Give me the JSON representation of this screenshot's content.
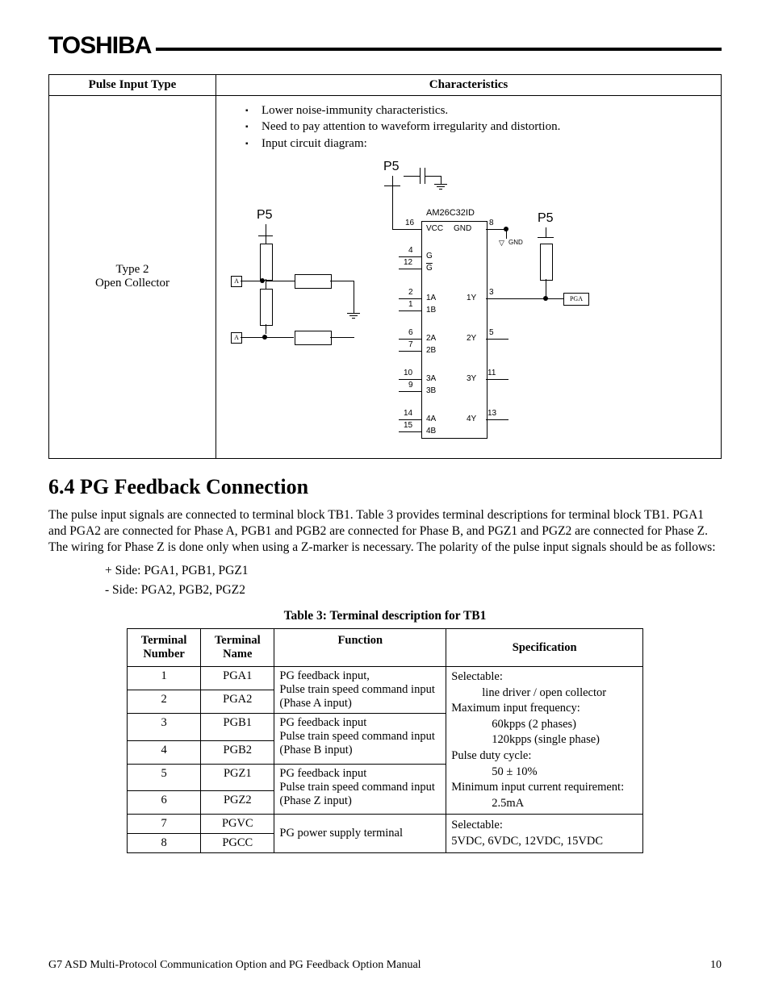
{
  "brand": "TOSHIBA",
  "table1": {
    "headers": [
      "Pulse Input Type",
      "Characteristics"
    ],
    "row_label": "Type 2\nOpen Collector",
    "bullets": [
      "Lower noise-immunity characteristics.",
      "Need to pay attention to waveform irregularity and distortion.",
      "Input circuit diagram:"
    ],
    "diagram_labels": {
      "p5a": "P5",
      "p5b": "P5",
      "p5c": "P5",
      "ic": "AM26C32ID",
      "vcc": "VCC",
      "gnd": "GND",
      "vgnd": "GND",
      "g": "G",
      "gbar": "G",
      "pin16": "16",
      "pin8": "8",
      "pin4": "4",
      "pin12": "12",
      "pin2": "2",
      "pin1": "1",
      "pin3": "3",
      "pin6": "6",
      "pin7": "7",
      "pin5": "5",
      "pin10": "10",
      "pin9": "9",
      "pin11": "11",
      "pin14": "14",
      "pin15": "15",
      "pin13": "13",
      "l1a": "1A",
      "l1b": "1B",
      "l1y": "1Y",
      "l2a": "2A",
      "l2b": "2B",
      "l2y": "2Y",
      "l3a": "3A",
      "l3b": "3B",
      "l3y": "3Y",
      "l4a": "4A",
      "l4b": "4B",
      "l4y": "4Y",
      "labA": "A",
      "labPGA": "PGA"
    }
  },
  "section_heading": "6.4  PG Feedback Connection",
  "para": "The pulse input signals are connected to terminal block TB1.  Table 3 provides terminal descriptions for terminal block TB1.   PGA1 and PGA2 are connected for Phase A, PGB1 and PGB2 are connected for Phase B, and PGZ1 and PGZ2 are connected for Phase Z.  The wiring for Phase Z is done only when using a Z-marker is necessary.  The polarity of the pulse input signals should be as follows:",
  "polarity_plus": "+ Side: PGA1, PGB1, PGZ1",
  "polarity_minus": "- Side: PGA2, PGB2, PGZ2",
  "table3_caption": "Table 3: Terminal description for TB1",
  "table3": {
    "headers": [
      "Terminal Number",
      "Terminal Name",
      "Function",
      "Specification"
    ],
    "rows": [
      {
        "num": "1",
        "name": "PGA1"
      },
      {
        "num": "2",
        "name": "PGA2"
      },
      {
        "num": "3",
        "name": "PGB1"
      },
      {
        "num": "4",
        "name": "PGB2"
      },
      {
        "num": "5",
        "name": "PGZ1"
      },
      {
        "num": "6",
        "name": "PGZ2"
      },
      {
        "num": "7",
        "name": "PGVC"
      },
      {
        "num": "8",
        "name": "PGCC"
      }
    ],
    "funcA1": "PG feedback input,",
    "funcA2": "Pulse train speed command input (Phase A input)",
    "funcB1": "PG feedback input",
    "funcB2": "Pulse train speed command input (Phase B input)",
    "funcZ1": "PG feedback input",
    "funcZ2": "Pulse train speed command input (Phase Z input)",
    "funcPwr": "PG power supply terminal",
    "spec1_l1": "Selectable:",
    "spec1_l2": "line driver / open collector",
    "spec1_l3": "Maximum input frequency:",
    "spec1_l4": "60kpps (2 phases)",
    "spec1_l5": "120kpps (single phase)",
    "spec1_l6": "Pulse duty cycle:",
    "spec1_l7": "50 ± 10%",
    "spec1_l8": "Minimum input current requirement:",
    "spec1_l9": "2.5mA",
    "spec2_l1": "Selectable:",
    "spec2_l2": "5VDC, 6VDC, 12VDC, 15VDC"
  },
  "footer_left": "G7 ASD Multi-Protocol Communication Option and PG Feedback Option Manual",
  "footer_right": "10"
}
